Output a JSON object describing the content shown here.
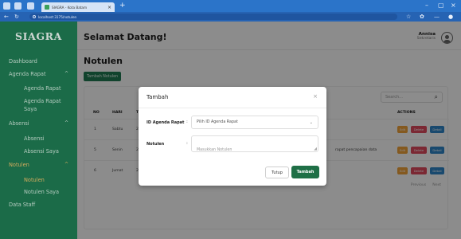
{
  "browser": {
    "tab_title": "SIAGRA - Kota Batam",
    "tab_close": "×",
    "new_tab": "+",
    "url": "localhost:3175/notulen",
    "window_controls": [
      "–",
      "▢",
      "×"
    ]
  },
  "sidebar": {
    "brand": "SIAGRA",
    "items": [
      {
        "label": "Dashboard"
      },
      {
        "label": "Agenda Rapat",
        "chevron": "^"
      },
      {
        "label": "Agenda Rapat"
      },
      {
        "label": "Agenda Rapat"
      },
      {
        "label": "Saya"
      },
      {
        "label": "Absensi",
        "chevron": "^"
      },
      {
        "label": "Absensi"
      },
      {
        "label": "Absensi Saya"
      },
      {
        "label": "Notulen",
        "chevron": "^"
      },
      {
        "label": "Notulen"
      },
      {
        "label": "Notulen Saya"
      },
      {
        "label": "Data Staff"
      }
    ]
  },
  "header": {
    "welcome": "Selamat Datang!",
    "user_name": "Annisa",
    "user_role": "Sekretaris"
  },
  "page": {
    "title": "Notulen",
    "add_button": "Tambah Notulen",
    "search_placeholder": "Search...",
    "columns": [
      "NO",
      "HARI",
      "T",
      "ACTIONS"
    ],
    "rows": [
      {
        "no": "1",
        "hari": "Sabtu",
        "t": "2",
        "extra": ""
      },
      {
        "no": "5",
        "hari": "Senin",
        "t": "2",
        "extra": "rapat pencapaian data"
      },
      {
        "no": "6",
        "hari": "Jumat",
        "t": "2",
        "extra": ""
      }
    ],
    "actions": {
      "edit": "Edit",
      "delete": "Delete",
      "detail": "Detail"
    },
    "pagination": {
      "prev": "Previous",
      "next": "Next"
    }
  },
  "modal": {
    "title": "Tambah",
    "close": "×",
    "agenda_label": "ID Agenda Rapat",
    "agenda_value": "Pilih ID Agenda Rapat",
    "notulen_label": "Notulen",
    "notulen_placeholder": "Masukkan Notulen",
    "colon": ":",
    "cancel_button": "Tutup",
    "submit_button": "Tambah"
  },
  "colors": {
    "primary": "#1f7a52",
    "accent": "#f0c36b",
    "browser": "#2b74c9"
  }
}
